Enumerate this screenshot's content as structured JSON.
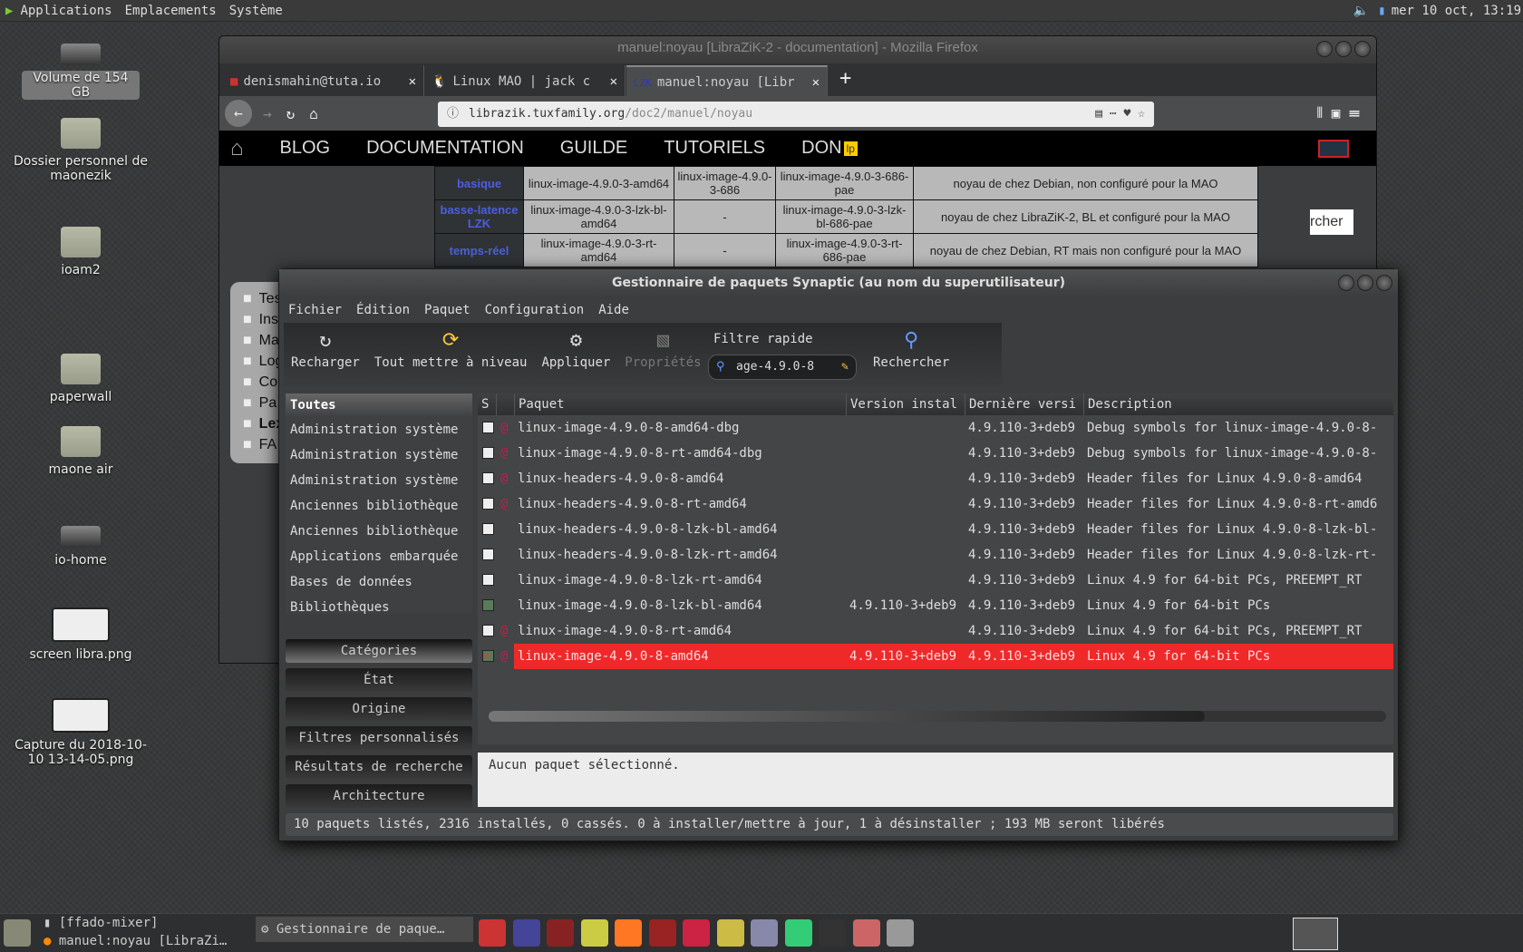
{
  "top_panel": {
    "menus": [
      "Applications",
      "Emplacements",
      "Système"
    ],
    "clock": "mer 10 oct, 13:19"
  },
  "desktop_icons": [
    {
      "label": "Volume de 154 GB",
      "type": "drive"
    },
    {
      "label": "Dossier personnel de maonezik",
      "type": "home-folder"
    },
    {
      "label": "ioam2",
      "type": "folder"
    },
    {
      "label": "paperwall",
      "type": "folder"
    },
    {
      "label": "maone air",
      "type": "folder"
    },
    {
      "label": "io-home",
      "type": "drive"
    },
    {
      "label": "screen libra.png",
      "type": "image"
    },
    {
      "label": "Capture du 2018-10-10 13-14-05.png",
      "type": "image"
    }
  ],
  "firefox": {
    "title": "manuel:noyau [LibraZiK-2 - documentation] - Mozilla Firefox",
    "tabs": [
      {
        "label": "denismahin@tuta.io"
      },
      {
        "label": "Linux MAO | jack c"
      },
      {
        "label": "manuel:noyau [Libr",
        "active": true
      }
    ],
    "url_host": "librazik.tuxfamily.org",
    "url_path": "/doc2/manuel/noyau",
    "site_nav": [
      "BLOG",
      "DOCUMENTATION",
      "GUILDE",
      "TUTORIELS",
      "DON"
    ],
    "table": [
      [
        "basique",
        "linux-image-4.9.0-3-amd64",
        "linux-image-4.9.0-3-686",
        "linux-image-4.9.0-3-686-pae",
        "noyau de chez Debian, non configuré pour la MAO"
      ],
      [
        "basse-latence LZK",
        "linux-image-4.9.0-3-lzk-bl-amd64",
        "-",
        "linux-image-4.9.0-3-lzk-bl-686-pae",
        "noyau de chez LibraZiK-2, BL et configuré pour la MAO"
      ],
      [
        "temps-réel",
        "linux-image-4.9.0-3-rt-amd64",
        "-",
        "linux-image-4.9.0-3-rt-686-pae",
        "noyau de chez Debian, RT mais non configuré pour la MAO"
      ]
    ],
    "sidebar_items": [
      "Testor",
      "Ins",
      "Ma",
      "Log",
      "Co",
      "Pa",
      "Lex",
      "FA"
    ],
    "search_button_partial": "rcher"
  },
  "synaptic": {
    "title": "Gestionnaire de paquets Synaptic  (au nom du superutilisateur)",
    "menu": [
      "Fichier",
      "Édition",
      "Paquet",
      "Configuration",
      "Aide"
    ],
    "toolbar": {
      "reload": "Recharger",
      "upgrade_all": "Tout mettre à niveau",
      "apply": "Appliquer",
      "properties": "Propriétés",
      "quick_filter_label": "Filtre rapide",
      "quick_filter_value": "age-4.9.0-8",
      "search": "Rechercher"
    },
    "sidebar": {
      "header": "Toutes",
      "items": [
        "Administration système",
        "Administration système",
        "Administration système",
        "Anciennes bibliothèque",
        "Anciennes bibliothèque",
        "Applications embarquée",
        "Bases de données",
        "Bibliothèques",
        "Bibliothèques"
      ]
    },
    "filter_buttons": [
      "Catégories",
      "État",
      "Origine",
      "Filtres personnalisés",
      "Résultats de recherche",
      "Architecture"
    ],
    "columns": [
      "S",
      "",
      "Paquet",
      "Version instal",
      "Dernière versi",
      "Description"
    ],
    "packages": [
      {
        "status": "not-installed",
        "debian": true,
        "name": "linux-image-4.9.0-8-amd64-dbg",
        "installed": "",
        "latest": "4.9.110-3+deb9",
        "description": "Debug symbols for linux-image-4.9.0-8-"
      },
      {
        "status": "not-installed",
        "debian": true,
        "name": "linux-image-4.9.0-8-rt-amd64-dbg",
        "installed": "",
        "latest": "4.9.110-3+deb9",
        "description": "Debug symbols for linux-image-4.9.0-8-"
      },
      {
        "status": "not-installed",
        "debian": true,
        "name": "linux-headers-4.9.0-8-amd64",
        "installed": "",
        "latest": "4.9.110-3+deb9",
        "description": "Header files for Linux 4.9.0-8-amd64"
      },
      {
        "status": "not-installed",
        "debian": true,
        "name": "linux-headers-4.9.0-8-rt-amd64",
        "installed": "",
        "latest": "4.9.110-3+deb9",
        "description": "Header files for Linux 4.9.0-8-rt-amd6"
      },
      {
        "status": "not-installed",
        "debian": false,
        "name": "linux-headers-4.9.0-8-lzk-bl-amd64",
        "installed": "",
        "latest": "4.9.110-3+deb9",
        "description": "Header files for Linux 4.9.0-8-lzk-bl-"
      },
      {
        "status": "not-installed",
        "debian": false,
        "name": "linux-headers-4.9.0-8-lzk-rt-amd64",
        "installed": "",
        "latest": "4.9.110-3+deb9",
        "description": "Header files for Linux 4.9.0-8-lzk-rt-"
      },
      {
        "status": "not-installed",
        "debian": false,
        "name": "linux-image-4.9.0-8-lzk-rt-amd64",
        "installed": "",
        "latest": "4.9.110-3+deb9",
        "description": "Linux 4.9 for 64-bit PCs, PREEMPT_RT"
      },
      {
        "status": "installed",
        "debian": false,
        "name": "linux-image-4.9.0-8-lzk-bl-amd64",
        "installed": "4.9.110-3+deb9",
        "latest": "4.9.110-3+deb9",
        "description": "Linux 4.9 for 64-bit PCs"
      },
      {
        "status": "not-installed",
        "debian": true,
        "name": "linux-image-4.9.0-8-rt-amd64",
        "installed": "",
        "latest": "4.9.110-3+deb9",
        "description": "Linux 4.9 for 64-bit PCs, PREEMPT_RT"
      },
      {
        "status": "marked-removal",
        "debian": true,
        "name": "linux-image-4.9.0-8-amd64",
        "installed": "4.9.110-3+deb9",
        "latest": "4.9.110-3+deb9",
        "description": "Linux 4.9 for 64-bit PCs",
        "selected": true
      }
    ],
    "description_panel": "Aucun paquet sélectionné.",
    "status_bar": "10 paquets listés, 2316 installés, 0 cassés. 0 à installer/mettre à jour, 1 à désinstaller ; 193 MB seront libérés",
    "colors": {
      "selected_row": "#ef2929",
      "installed_checkbox": "#5a7a5a"
    }
  },
  "taskbar": {
    "windows": [
      "[ffado-mixer]",
      "manuel:noyau [LibraZi…",
      "Gestionnaire de paque…"
    ],
    "launchers": [
      "ffado-icon",
      "hydrogen-icon",
      "terminal-red-icon",
      "music-icon",
      "firefox-icon",
      "carla-icon",
      "ardour-icon",
      "pen-icon",
      "video-icon",
      "headphones-icon",
      "terminal-icon",
      "package-icon",
      "screenshot-icon"
    ]
  }
}
